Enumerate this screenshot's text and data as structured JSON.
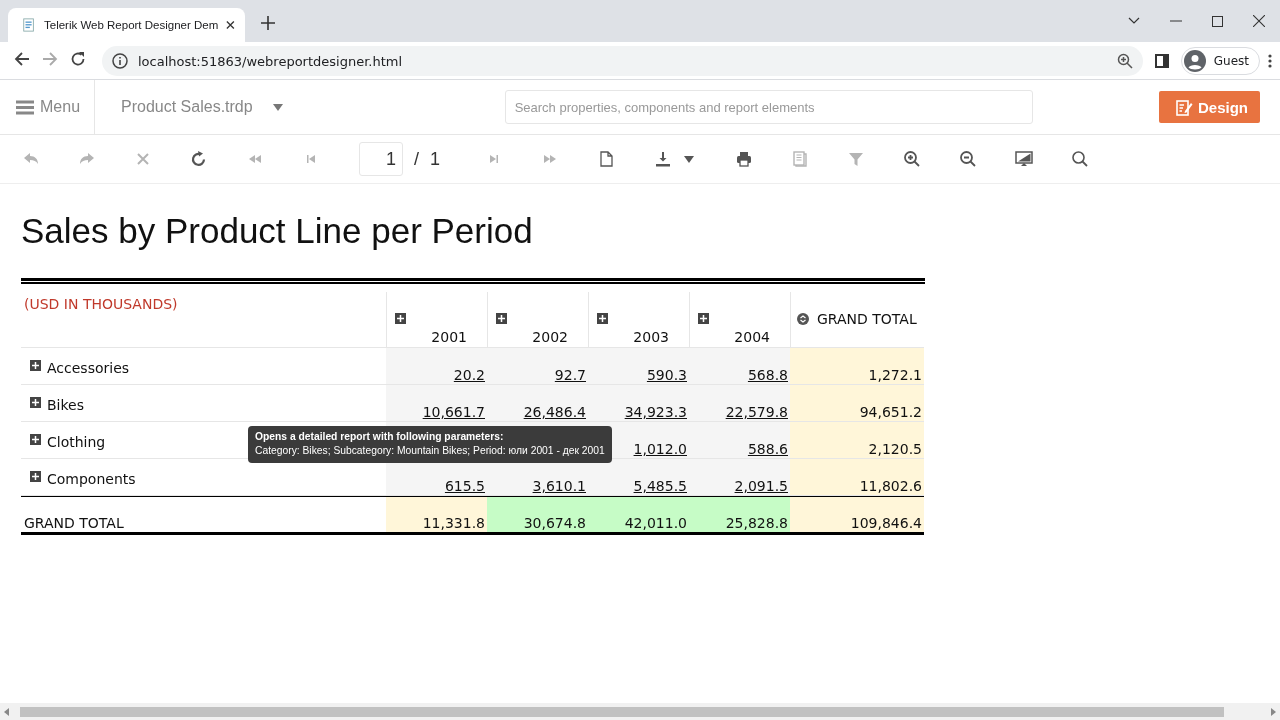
{
  "browser": {
    "tab_title": "Telerik Web Report Designer Dem",
    "url": "localhost:51863/webreportdesigner.html",
    "profile": "Guest"
  },
  "app_bar": {
    "menu": "Menu",
    "report_name": "Product Sales.trdp",
    "search": {
      "placeholder": "Search properties, components and report elements"
    },
    "design_button": "Design"
  },
  "viewer_toolbar": {
    "items": [
      {
        "kind": "undo",
        "disabled": true
      },
      {
        "kind": "redo",
        "disabled": true
      },
      {
        "kind": "stop",
        "disabled": true
      },
      {
        "kind": "refresh",
        "disabled": false
      },
      {
        "kind": "first",
        "disabled": true
      },
      {
        "kind": "prev",
        "disabled": true
      },
      {
        "kind": "page",
        "value": "1",
        "separator": "/",
        "total": "1"
      },
      {
        "kind": "next",
        "disabled": true
      },
      {
        "kind": "last",
        "disabled": true
      },
      {
        "kind": "document",
        "disabled": false
      },
      {
        "kind": "export",
        "disabled": false
      },
      {
        "kind": "print",
        "disabled": false
      },
      {
        "kind": "pages",
        "disabled": true
      },
      {
        "kind": "filter",
        "disabled": true
      },
      {
        "kind": "zoom_in",
        "disabled": false
      },
      {
        "kind": "zoom_out",
        "disabled": false
      },
      {
        "kind": "monitor",
        "disabled": false
      },
      {
        "kind": "search",
        "disabled": false
      }
    ]
  },
  "report": {
    "title": "Sales by Product Line per Period",
    "unit_label": "(USD IN THOUSANDS)",
    "columns": [
      "2001",
      "2002",
      "2003",
      "2004"
    ],
    "grand_total_header": "GRAND TOTAL",
    "rows": [
      {
        "label": "Accessories",
        "values": [
          "20.2",
          "92.7",
          "590.3",
          "568.8"
        ],
        "total": "1,272.1"
      },
      {
        "label": "Bikes",
        "values": [
          "10,661.7",
          "26,486.4",
          "34,923.3",
          "22,579.8"
        ],
        "total": "94,651.2"
      },
      {
        "label": "Clothing",
        "values": [
          "1,012.0",
          "588.6"
        ],
        "total": "2,120.5"
      },
      {
        "label": "Components",
        "values": [
          "615.5",
          "3,610.1",
          "5,485.5",
          "2,091.5"
        ],
        "total": "11,802.6"
      }
    ],
    "grand_total_row": {
      "label": "GRAND TOTAL",
      "cells": [
        {
          "value": "11,331.8",
          "color": "#fff6d9"
        },
        {
          "value": "30,674.8",
          "color": "#c6fcc6"
        },
        {
          "value": "42,011.0",
          "color": "#c6fcc6"
        },
        {
          "value": "25,828.8",
          "color": "#c6fcc6"
        },
        {
          "value": "109,846.4",
          "color": "#fff6d9"
        }
      ]
    }
  },
  "tooltip": {
    "title": "Opens a detailed report with following parameters:",
    "text": "Category: Bikes; Subcategory: Mountain Bikes; Period: юли 2001 - дек 2001"
  }
}
